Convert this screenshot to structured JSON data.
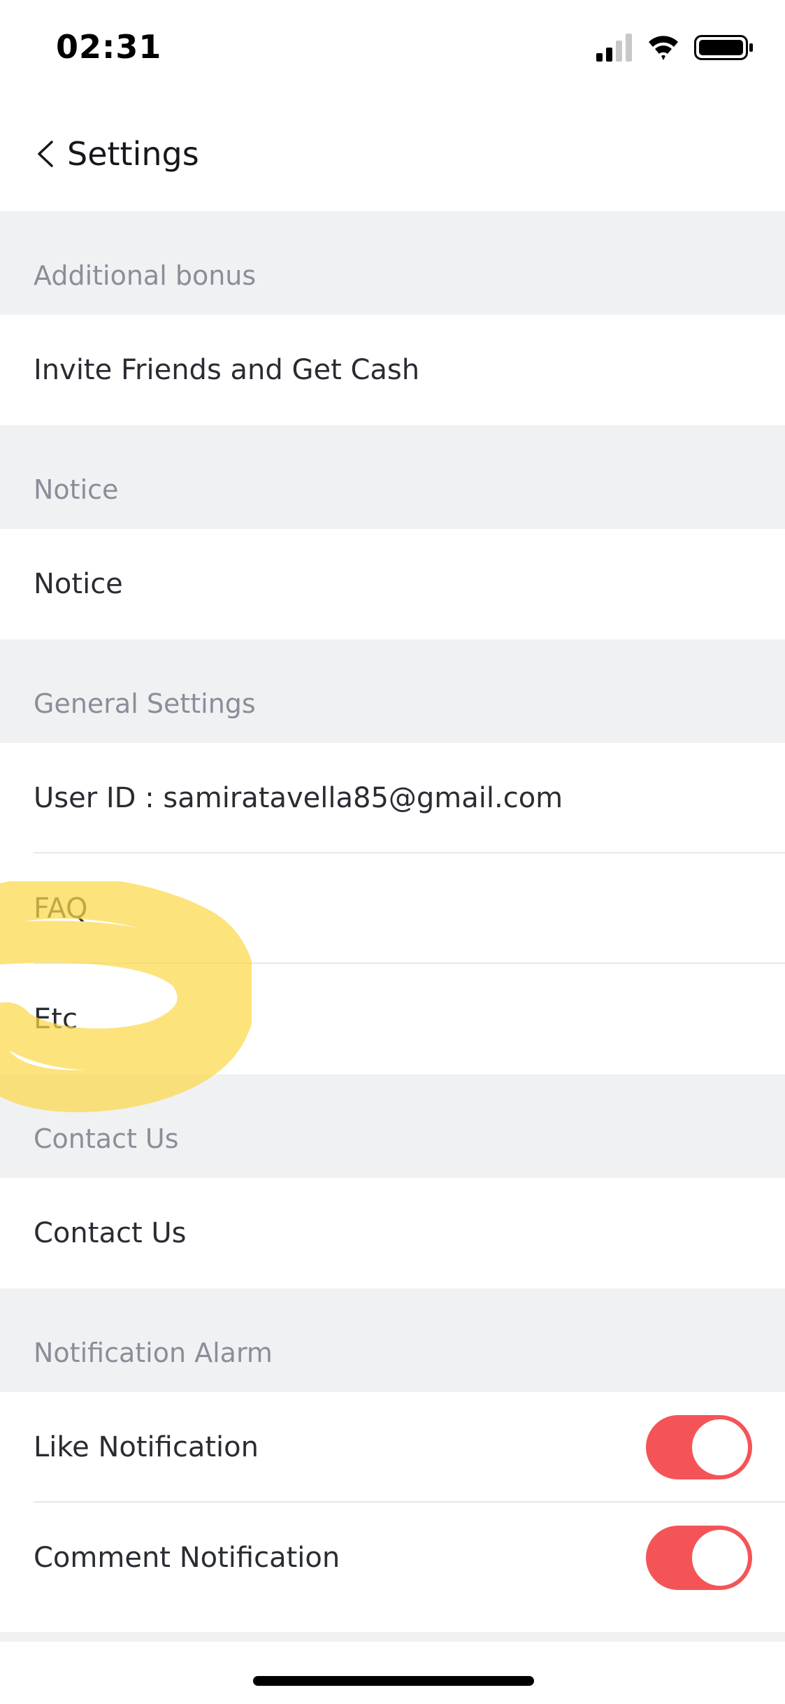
{
  "status_bar": {
    "time": "02:31",
    "icons": [
      "signal-icon",
      "wifi-icon",
      "battery-icon"
    ]
  },
  "nav": {
    "title": "Settings",
    "back_icon": "chevron-left-icon"
  },
  "sections": {
    "additional_bonus": {
      "header": "Additional bonus",
      "items": [
        "Invite Friends and Get Cash"
      ]
    },
    "notice": {
      "header": "Notice",
      "items": [
        "Notice"
      ]
    },
    "general_settings": {
      "header": "General Settings",
      "items": [
        "User ID : samiratavella85@gmail.com",
        "FAQ",
        "Etc"
      ]
    },
    "contact_us": {
      "header": "Contact Us",
      "items": [
        "Contact Us"
      ]
    },
    "notification_alarm": {
      "header": "Notification Alarm",
      "items": [
        {
          "label": "Like Notification",
          "enabled": true
        },
        {
          "label": "Comment Notification",
          "enabled": true
        }
      ]
    }
  },
  "colors": {
    "toggle_on": "#f45458",
    "section_background": "#f0f1f3",
    "section_header_text": "#8b8e99",
    "highlight_annotation": "#fbd84a"
  }
}
